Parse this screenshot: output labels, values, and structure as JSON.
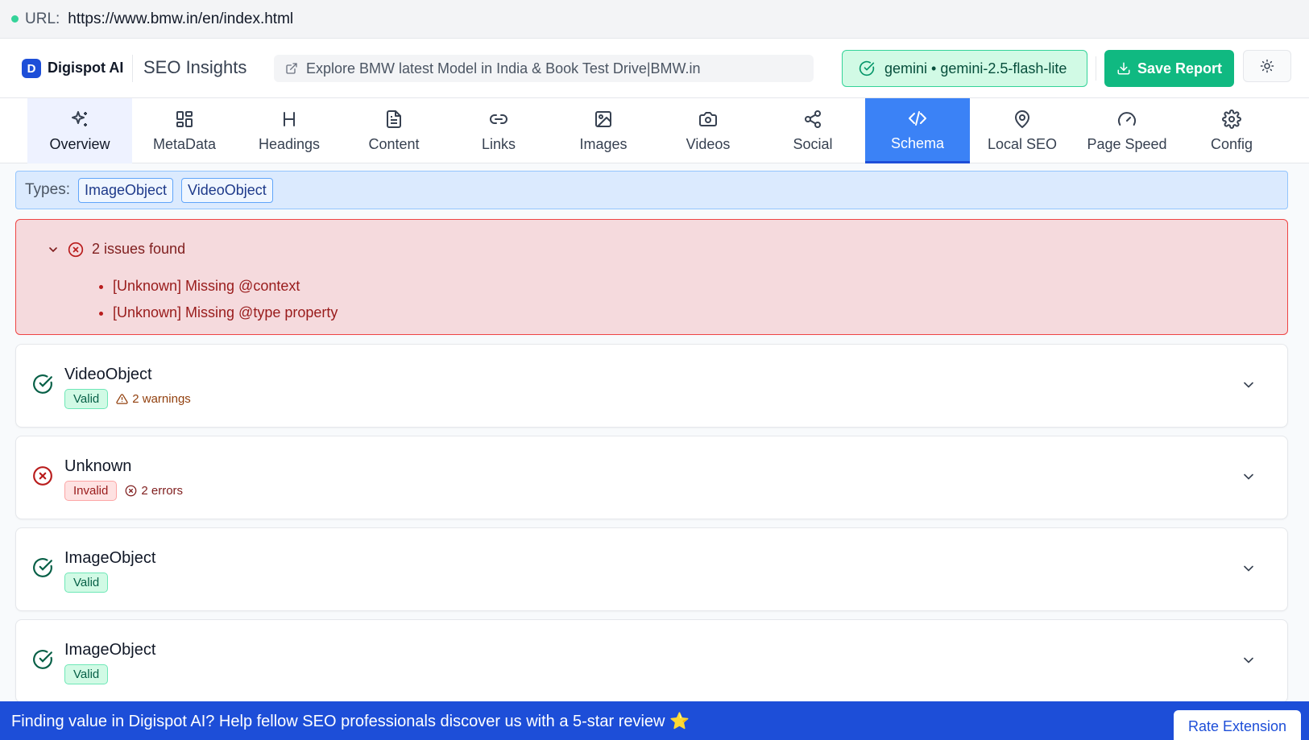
{
  "url_bar": {
    "label": "URL:",
    "value": "https://www.bmw.in/en/index.html"
  },
  "header": {
    "logo_letter": "D",
    "brand": "Digispot AI",
    "app_title": "SEO Insights",
    "page_title": "Explore BMW latest Model in India & Book Test Drive|BMW.in",
    "model": "gemini • gemini-2.5-flash-lite",
    "save_label": "Save Report",
    "theme_icon": "sun-icon"
  },
  "tabs": [
    {
      "label": "Overview",
      "icon": "sparkles-icon"
    },
    {
      "label": "MetaData",
      "icon": "grid-icon"
    },
    {
      "label": "Headings",
      "icon": "heading-icon"
    },
    {
      "label": "Content",
      "icon": "document-icon"
    },
    {
      "label": "Links",
      "icon": "link-icon"
    },
    {
      "label": "Images",
      "icon": "image-icon"
    },
    {
      "label": "Videos",
      "icon": "camera-icon"
    },
    {
      "label": "Social",
      "icon": "share-icon"
    },
    {
      "label": "Schema",
      "icon": "code-icon",
      "active": true
    },
    {
      "label": "Local SEO",
      "icon": "map-pin-icon"
    },
    {
      "label": "Page Speed",
      "icon": "gauge-icon"
    },
    {
      "label": "Config",
      "icon": "gear-icon"
    }
  ],
  "types": {
    "label": "Types:",
    "items": [
      "ImageObject",
      "VideoObject"
    ]
  },
  "issues": {
    "title": "2 issues found",
    "items": [
      "[Unknown] Missing @context",
      "[Unknown] Missing @type property"
    ]
  },
  "schemas": [
    {
      "name": "VideoObject",
      "status": "Valid",
      "note": "2 warnings"
    },
    {
      "name": "Unknown",
      "status": "Invalid",
      "note": "2 errors"
    },
    {
      "name": "ImageObject",
      "status": "Valid",
      "note": ""
    },
    {
      "name": "ImageObject",
      "status": "Valid",
      "note": ""
    }
  ],
  "banner": {
    "text": "Finding value in Digispot AI? Help fellow SEO professionals discover us with a 5-star review ⭐",
    "button": "Rate Extension"
  },
  "colors": {
    "accent_green": "#10b981",
    "active_tab": "#3b82f6",
    "error_red": "#ef4444",
    "banner_blue": "#1d4ed8"
  }
}
